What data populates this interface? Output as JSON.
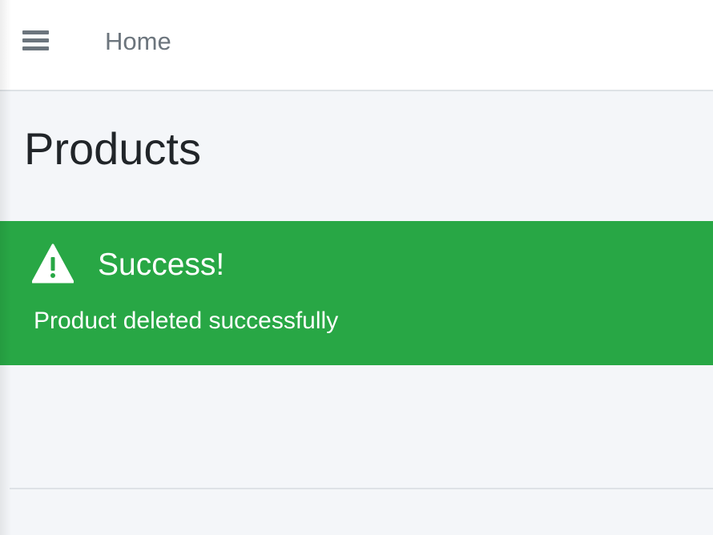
{
  "navbar": {
    "menu_icon": "hamburger-menu-icon",
    "home_link": "Home"
  },
  "content_header": {
    "title": "Products"
  },
  "alert": {
    "icon": "warning-triangle-icon",
    "heading": "Success!",
    "message": "Product deleted successfully",
    "background_color": "#28a745",
    "text_color": "#ffffff"
  },
  "colors": {
    "page_background": "#f4f6f9",
    "navbar_background": "#ffffff",
    "nav_text": "#6c757d",
    "title_text": "#212529",
    "divider": "#dee2e6"
  }
}
